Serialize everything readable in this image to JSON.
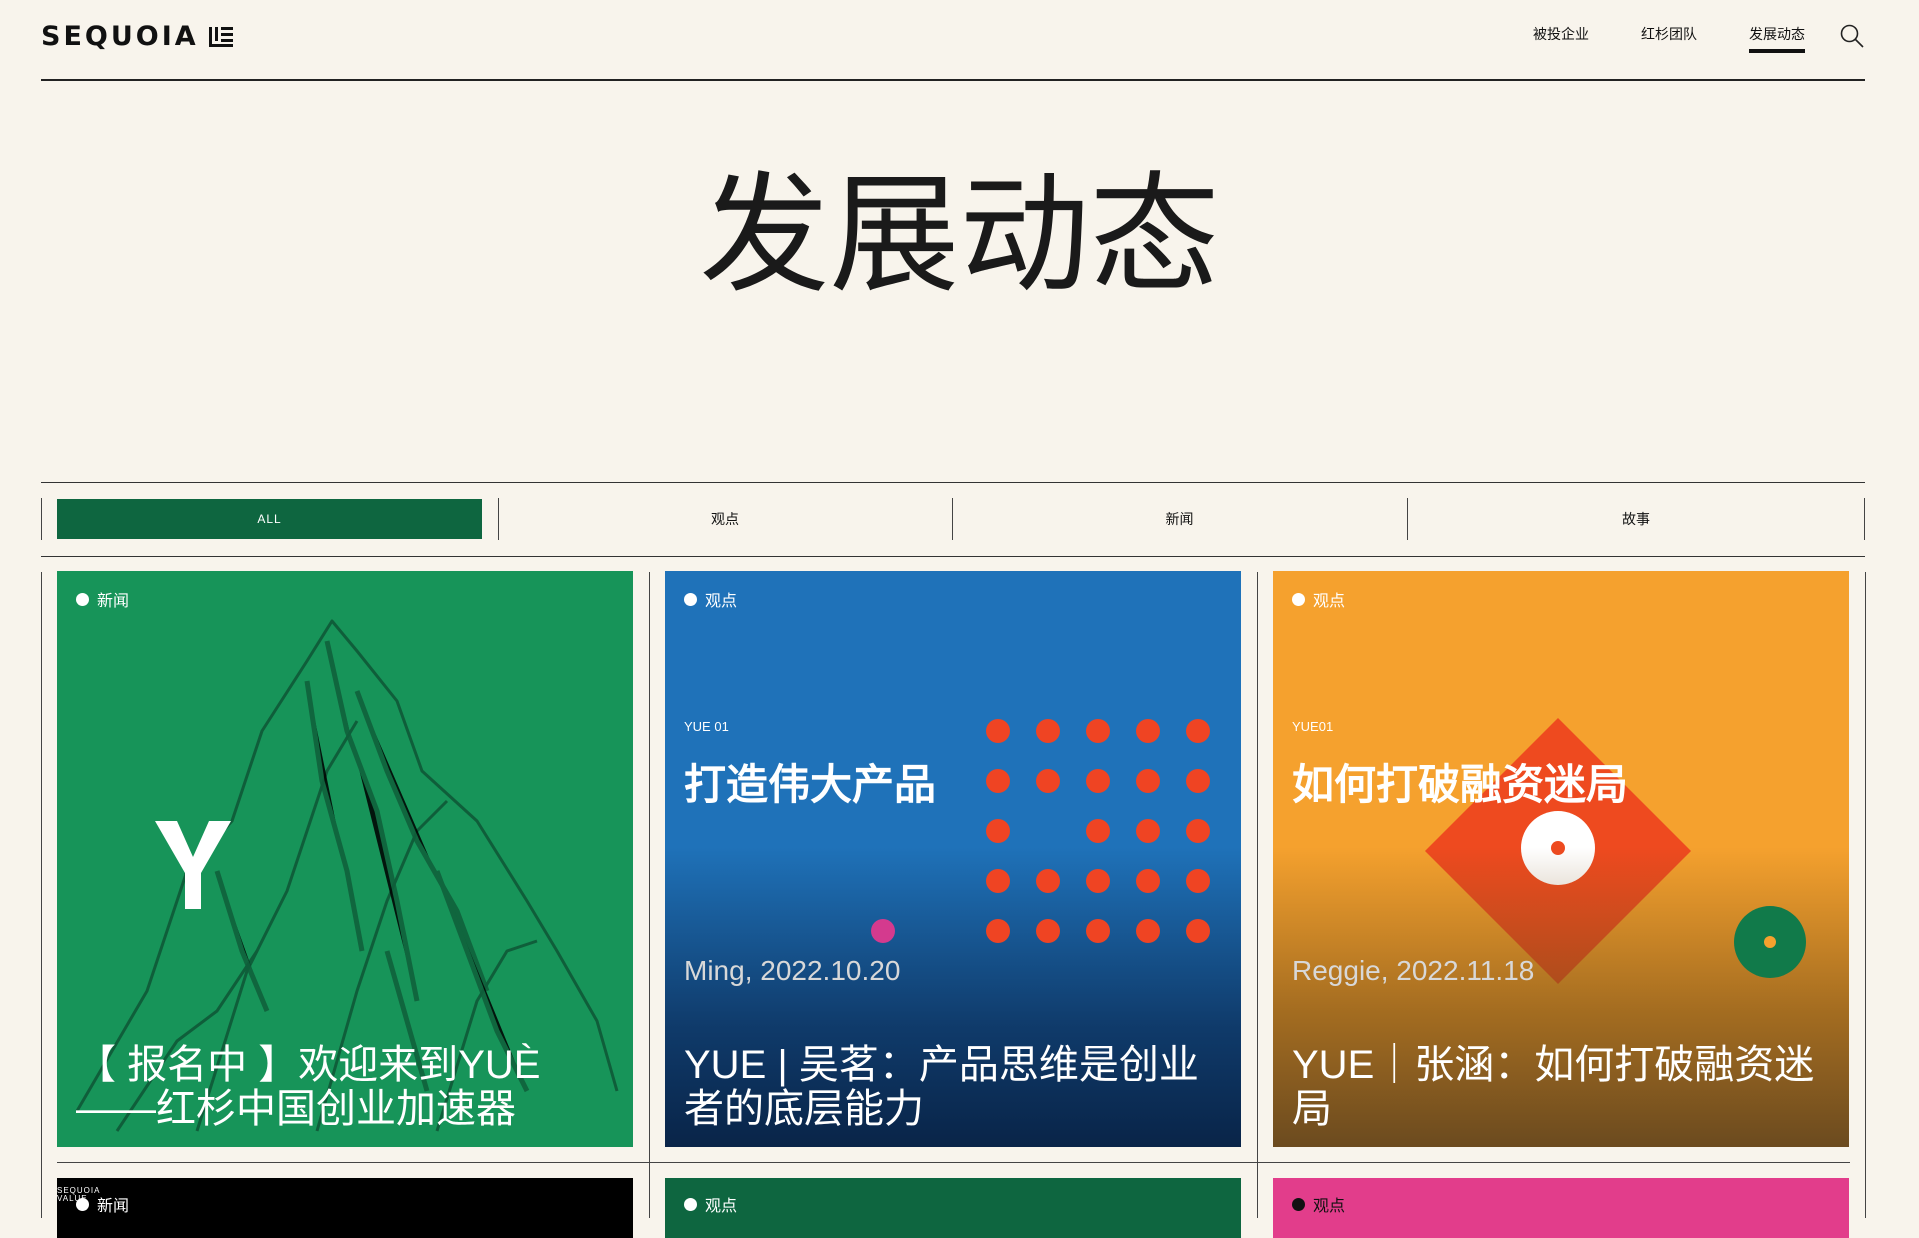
{
  "brand": {
    "name": "SEQUOIA"
  },
  "nav": {
    "items": [
      {
        "label": "被投企业",
        "active": false
      },
      {
        "label": "红杉团队",
        "active": false
      },
      {
        "label": "发展动态",
        "active": true
      }
    ],
    "search_icon": "search-icon"
  },
  "page": {
    "title": "发展动态"
  },
  "filters": {
    "tabs": [
      {
        "label": "ALL",
        "active": true
      },
      {
        "label": "观点",
        "active": false
      },
      {
        "label": "新闻",
        "active": false
      },
      {
        "label": "故事",
        "active": false
      }
    ],
    "active_color": "#0e6640"
  },
  "cards": [
    {
      "tag": "新闻",
      "title": "【 报名中 】欢迎来到YUÈ——红杉中国创业加速器",
      "cover": {
        "logo_letter": "Y",
        "illustration": "mountain-illustration"
      },
      "bg_color": "#179459"
    },
    {
      "tag": "观点",
      "title": "YUE | 吴茗：产品思维是创业者的底层能力",
      "cover": {
        "series": "YUE 01",
        "headline": "打造伟大产品",
        "byline": "Ming, 2022.10.20"
      },
      "bg_color": "#1f72b9"
    },
    {
      "tag": "观点",
      "title": "YUE｜张涵：如何打破融资迷局",
      "cover": {
        "series": "YUE01",
        "headline": "如何打破融资迷局",
        "byline": "Reggie, 2022.11.18"
      },
      "bg_color": "#f5a12e"
    }
  ],
  "cards_row2": [
    {
      "tag": "新闻",
      "bg_color": "#000000",
      "cover_text": "SEQUOIA VALUE"
    },
    {
      "tag": "观点",
      "bg_color": "#0e6640"
    },
    {
      "tag": "观点",
      "bg_color": "#e23d8b"
    }
  ]
}
